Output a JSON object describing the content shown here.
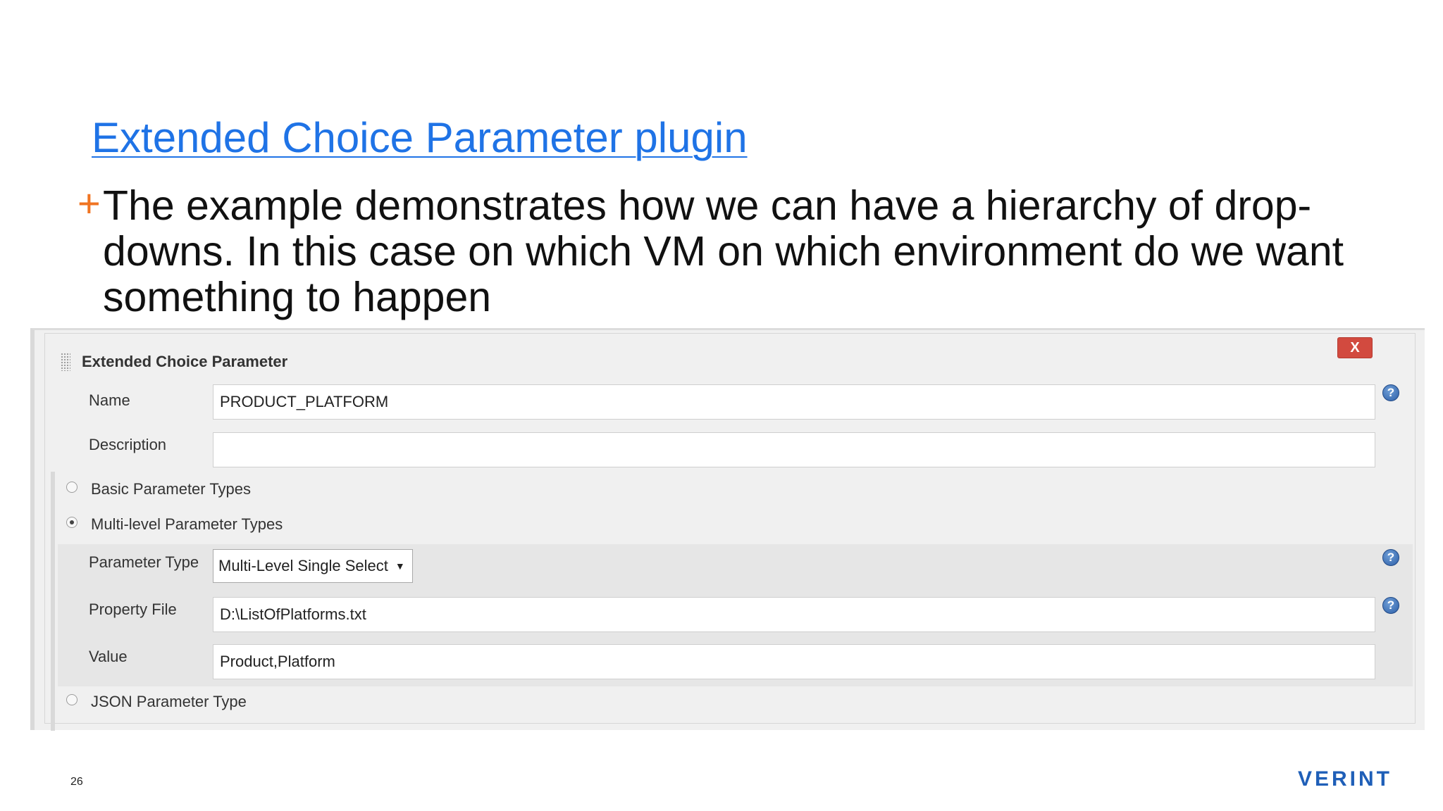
{
  "slide": {
    "title": "Extended Choice Parameter plugin",
    "bullet_marker": "+",
    "bullet_text": "The example demonstrates how we can have a hierarchy of drop-downs. In this case on which VM on which environment do we want something to happen",
    "page_number": "26",
    "logo": "VERINT"
  },
  "panel": {
    "header": "Extended Choice Parameter",
    "close_label": "X",
    "name_label": "Name",
    "name_value": "PRODUCT_PLATFORM",
    "description_label": "Description",
    "description_value": "",
    "radios": [
      {
        "label": "Basic Parameter Types",
        "checked": false
      },
      {
        "label": "Multi-level Parameter Types",
        "checked": true
      },
      {
        "label": "JSON Parameter Type",
        "checked": false
      }
    ],
    "parameter_type_label": "Parameter Type",
    "parameter_type_value": "Multi-Level Single Select",
    "property_file_label": "Property File",
    "property_file_value": "D:\\ListOfPlatforms.txt",
    "value_label": "Value",
    "value_value": "Product,Platform",
    "help_glyph": "?"
  },
  "colors": {
    "title": "#1f73e6",
    "bullet_marker": "#f07422",
    "close_button": "#d24a3f",
    "logo": "#1f5fb8"
  }
}
